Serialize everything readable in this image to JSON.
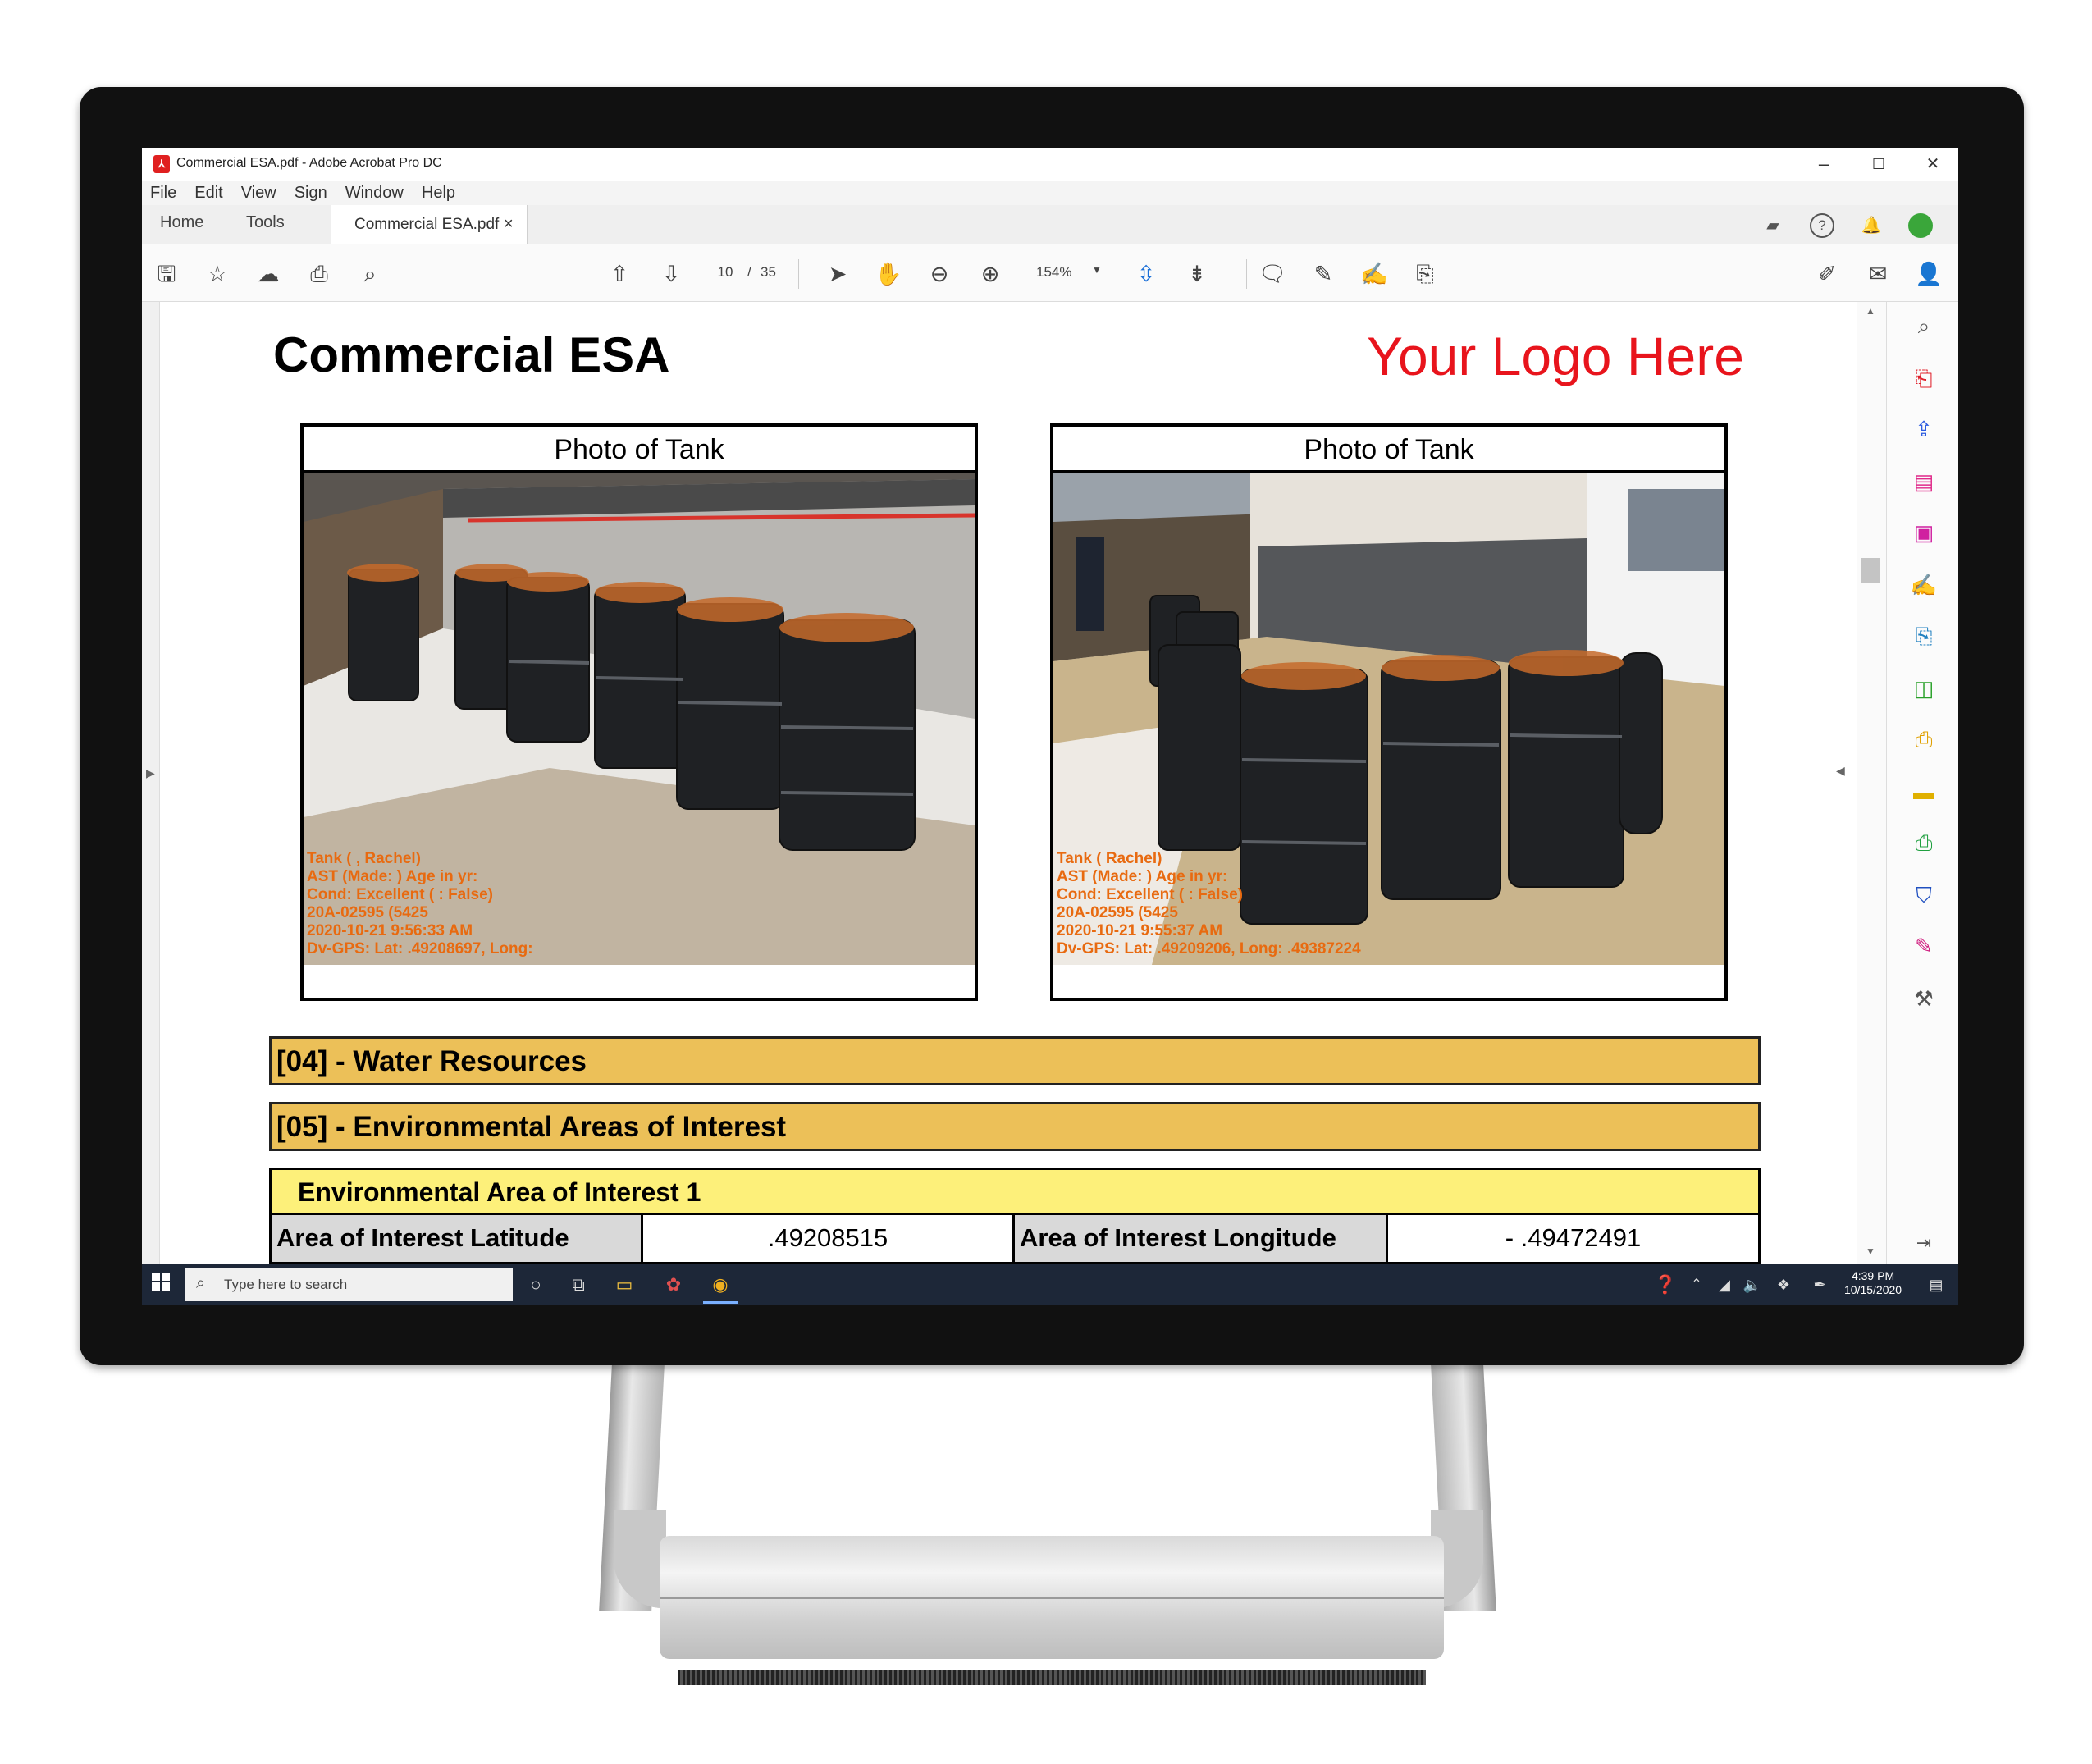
{
  "window": {
    "title": "Commercial ESA.pdf - Adobe Acrobat Pro DC",
    "minimize_glyph": "–",
    "maximize_glyph": "☐",
    "close_glyph": "✕"
  },
  "menu": [
    "File",
    "Edit",
    "View",
    "Sign",
    "Window",
    "Help"
  ],
  "tabs": {
    "home": "Home",
    "tools": "Tools",
    "document": "Commercial ESA.pdf",
    "close_glyph": "×"
  },
  "toolbar": {
    "page_current": "10",
    "page_separator": "/",
    "page_total": "35",
    "zoom": "154%"
  },
  "document": {
    "title": "Commercial ESA",
    "logo_text": "Your Logo Here",
    "photos": [
      {
        "caption": "Photo of Tank",
        "stamp_lines": [
          "Tank (    , Rachel)",
          "AST (Made: ) Age in yr:",
          "Cond: Excellent (          : False)",
          "                            20A-02595 (5425",
          "2020-10-21 9:56:33 AM",
          "Dv-GPS: Lat:   .49208697, Long:"
        ]
      },
      {
        "caption": "Photo of Tank",
        "stamp_lines": [
          "Tank (     Rachel)",
          "AST (Made: ) Age in yr:",
          "Cond: Excellent (         : False)",
          "                            20A-02595 (5425",
          "2020-10-21 9:55:37 AM",
          "Dv-GPS: Lat:   .49209206, Long:     .49387224"
        ]
      }
    ],
    "sections": [
      {
        "label": "[04] - Water Resources"
      },
      {
        "label": "[05] - Environmental Areas of Interest"
      }
    ],
    "subsection": "Environmental Area of Interest 1",
    "table_row": {
      "lat_label": "Area of Interest Latitude",
      "lat_value": ".49208515",
      "lon_label": "Area of Interest Longitude",
      "lon_value": "-  .49472491"
    }
  },
  "taskbar": {
    "search_placeholder": "Type here to search",
    "time": "4:39 PM",
    "date": "10/15/2020"
  },
  "colors": {
    "logo_red": "#e8141c",
    "section_gold": "#ecc058",
    "subsection_yellow": "#fdf07a",
    "taskbar_bg": "#1d2738",
    "stamp_orange": "#e86a10"
  }
}
